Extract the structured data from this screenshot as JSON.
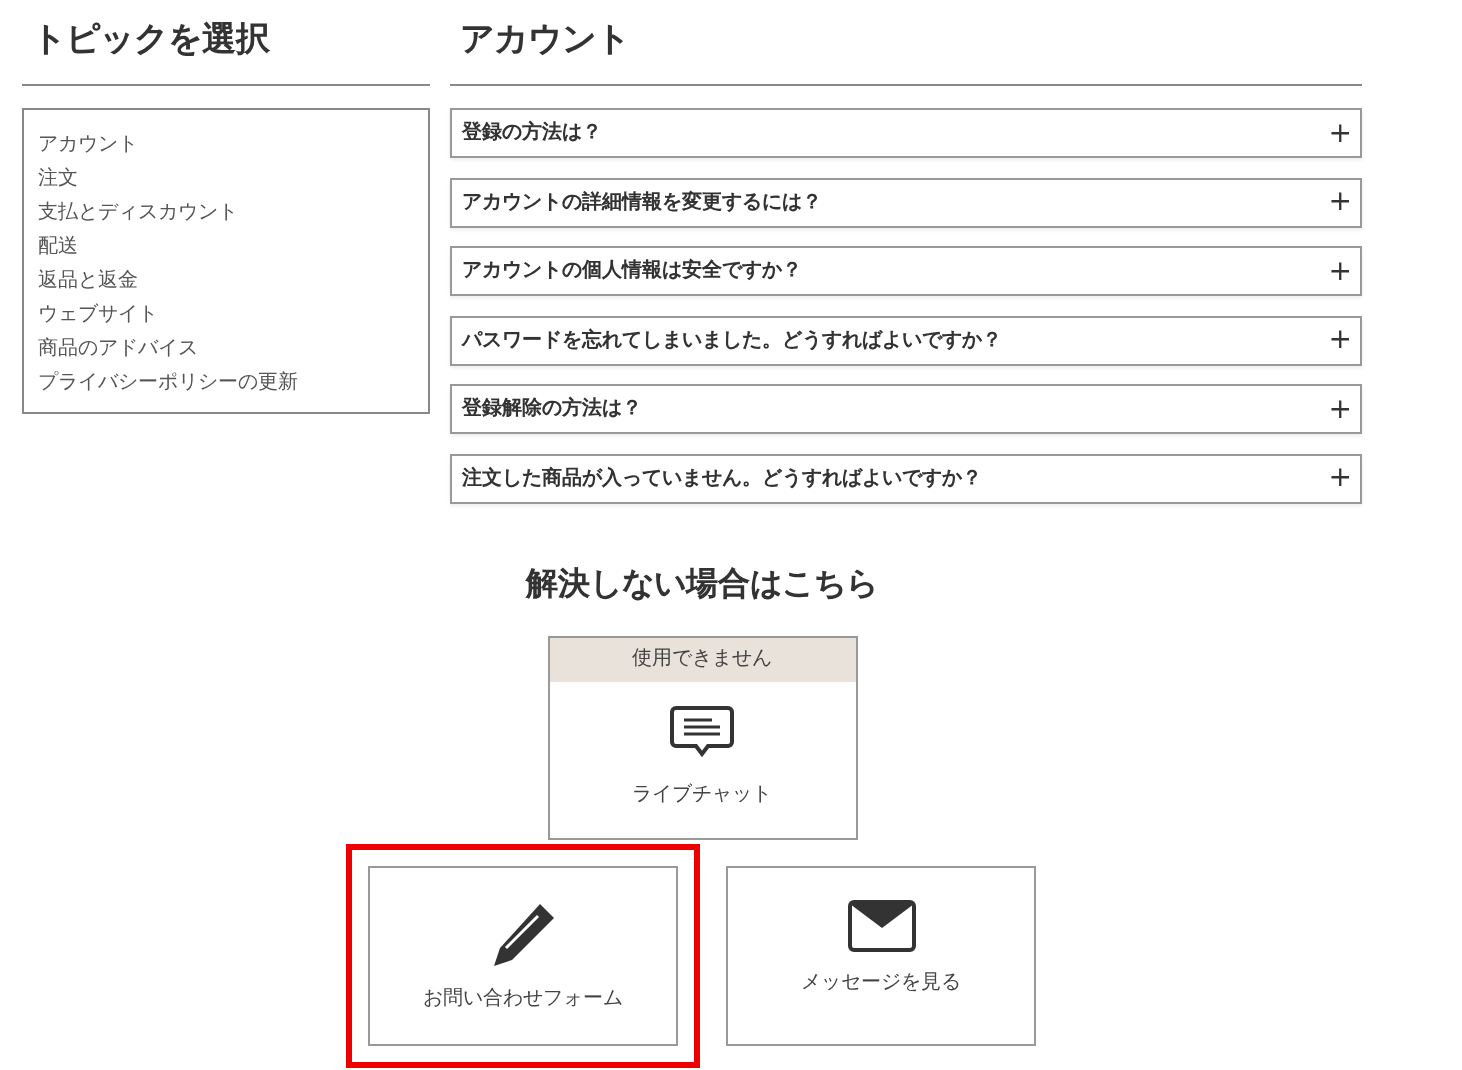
{
  "topics": {
    "title": "トピックを選択",
    "items": [
      {
        "label": "アカウント"
      },
      {
        "label": "注文"
      },
      {
        "label": "支払とディスカウント"
      },
      {
        "label": "配送"
      },
      {
        "label": "返品と返金"
      },
      {
        "label": "ウェブサイト"
      },
      {
        "label": "商品のアドバイス"
      },
      {
        "label": "プライバシーポリシーの更新"
      }
    ]
  },
  "faq": {
    "title": "アカウント",
    "questions": [
      {
        "text": "登録の方法は？",
        "expanded": false,
        "toggle": "+"
      },
      {
        "text": "アカウントの詳細情報を変更するには？",
        "expanded": false,
        "toggle": "+"
      },
      {
        "text": "アカウントの個人情報は安全ですか？",
        "expanded": false,
        "toggle": "+"
      },
      {
        "text": "パスワードを忘れてしまいました。どうすればよいですか？",
        "expanded": false,
        "toggle": "+"
      },
      {
        "text": "登録解除の方法は？",
        "expanded": false,
        "toggle": "+"
      },
      {
        "text": "注文した商品が入っていません。どうすればよいですか？",
        "expanded": false,
        "toggle": "+"
      }
    ]
  },
  "help": {
    "title": "解決しない場合はこちら",
    "options": [
      {
        "kind": "chat",
        "status": "使用できません",
        "label": "ライブチャット",
        "highlighted": false
      },
      {
        "kind": "form",
        "label": "お問い合わせフォーム",
        "highlighted": true
      },
      {
        "kind": "message",
        "label": "メッセージを見る",
        "highlighted": false
      }
    ]
  }
}
